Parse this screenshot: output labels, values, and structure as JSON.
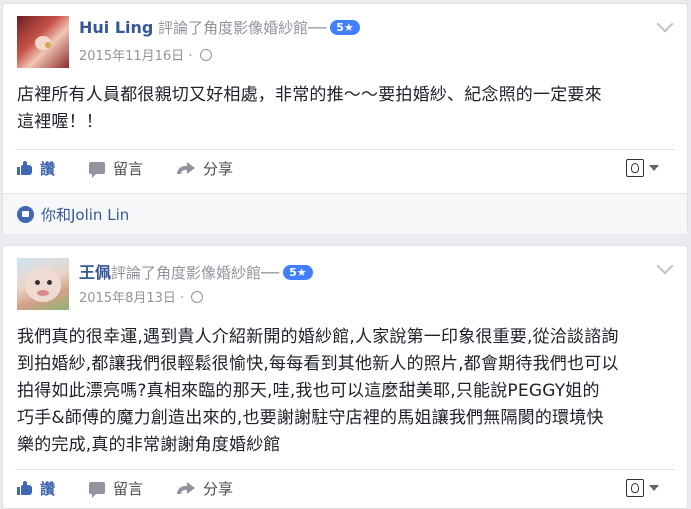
{
  "posts": [
    {
      "author": "Hui Ling",
      "action_text": "評論了角度影像婚紗館──",
      "badge": "5★",
      "date": "2015年11月16日",
      "separator": "·",
      "body_lines": [
        "店裡所有人員都很親切又好相處，非常的推～～要拍婚紗、紀念照的一定要來",
        "這裡喔！！"
      ],
      "actions": {
        "like": "讚",
        "comment": "留言",
        "share": "分享"
      },
      "reactions": "你和Jolin Lin"
    },
    {
      "author": "王佩",
      "action_text": "評論了角度影像婚紗館──",
      "badge": "5★",
      "date": "2015年8月13日",
      "separator": "·",
      "body_lines": [
        "我們真的很幸運,遇到貴人介紹新開的婚紗館,人家說第一印象很重要,從洽談諮詢",
        "到拍婚紗,都讓我們很輕鬆很愉快,每每看到其他新人的照片,都會期待我們也可以",
        "拍得如此漂亮嗎?真相來臨的那天,哇,我也可以這麼甜美耶,只能說PEGGY姐的",
        "巧手&師傅的魔力創造出來的,也要謝謝駐守店裡的馬姐讓我們無隔閡的環境快",
        "樂的完成,真的非常謝謝角度婚紗館"
      ],
      "actions": {
        "like": "讚",
        "comment": "留言",
        "share": "分享"
      }
    }
  ]
}
